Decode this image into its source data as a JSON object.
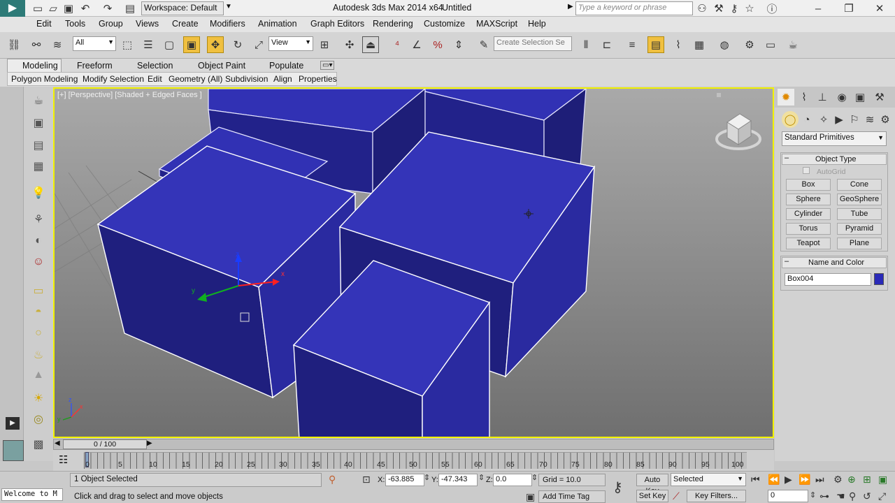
{
  "title": {
    "workspace": "Workspace: Default",
    "app": "Autodesk 3ds Max  2014 x64",
    "doc": "Untitled",
    "search_placeholder": "Type a keyword or phrase"
  },
  "menu": [
    "Edit",
    "Tools",
    "Group",
    "Views",
    "Create",
    "Modifiers",
    "Animation",
    "Graph Editors",
    "Rendering",
    "Customize",
    "MAXScript",
    "Help"
  ],
  "toolbar": {
    "selection_filter": "All",
    "ref_coord": "View",
    "named_selection_placeholder": "Create Selection Se"
  },
  "ribbon": {
    "tabs": [
      "Modeling",
      "Freeform",
      "Selection",
      "Object Paint",
      "Populate"
    ],
    "subtabs": [
      "Polygon Modeling",
      "Modify Selection",
      "Edit",
      "Geometry (All)",
      "Subdivision",
      "Align",
      "Properties"
    ]
  },
  "viewport": {
    "label": "[+] [Perspective] [Shaded + Edged Faces ]",
    "gizmo_x": "x",
    "gizmo_y": "y",
    "gizmo_z": "z",
    "mini_x": "x",
    "mini_y": "y",
    "mini_z": "z"
  },
  "cmdpanel": {
    "category": "Standard Primitives",
    "object_type_header": "Object Type",
    "autogrid": "AutoGrid",
    "buttons": [
      "Box",
      "Cone",
      "Sphere",
      "GeoSphere",
      "Cylinder",
      "Tube",
      "Torus",
      "Pyramid",
      "Teapot",
      "Plane"
    ],
    "name_color_header": "Name and Color",
    "object_name": "Box004",
    "object_color": "#2a2ab8"
  },
  "timeline": {
    "frame_counter": "0 / 100",
    "ticks": [
      "0",
      "5",
      "10",
      "15",
      "20",
      "25",
      "30",
      "35",
      "40",
      "45",
      "50",
      "55",
      "60",
      "65",
      "70",
      "75",
      "80",
      "85",
      "90",
      "95",
      "100"
    ]
  },
  "status": {
    "listener": "Welcome to M",
    "selected": "1 Object Selected",
    "prompt": "Click and drag to select and move objects",
    "x_label": "X:",
    "x": "-63.885",
    "y_label": "Y:",
    "y": "-47.343",
    "z_label": "Z:",
    "z": "0.0",
    "grid": "Grid = 10.0",
    "auto_key": "Auto Key",
    "set_key": "Set Key",
    "key_mode": "Selected",
    "key_filters": "Key Filters...",
    "add_time_tag": "Add Time Tag",
    "frame": "0"
  },
  "colors": {
    "box_top": "#3131b4",
    "box_side_light": "#2a2aa0",
    "box_side_dark": "#1e1e78",
    "viewport_border": "#f2f200"
  }
}
